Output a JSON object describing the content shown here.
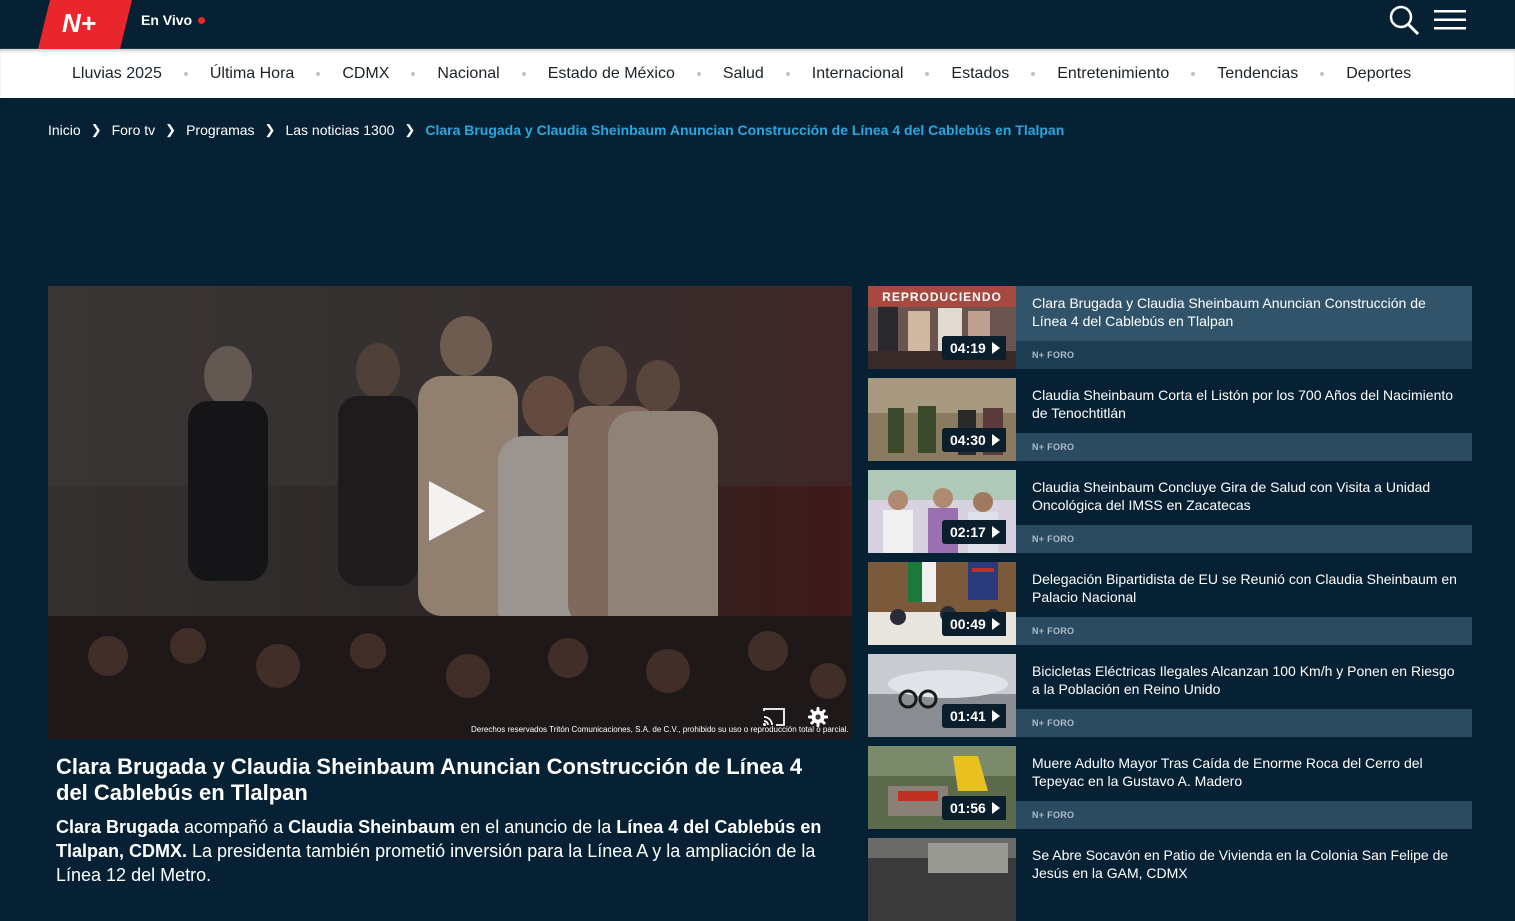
{
  "header": {
    "live_label": "En Vivo",
    "colors": {
      "background": "#062133",
      "logo_red": "#e8262c",
      "accent_blue": "#29a8e0"
    }
  },
  "nav": {
    "items": [
      "Lluvias 2025",
      "Última Hora",
      "CDMX",
      "Nacional",
      "Estado de México",
      "Salud",
      "Internacional",
      "Estados",
      "Entretenimiento",
      "Tendencias",
      "Deportes"
    ]
  },
  "breadcrumb": {
    "items": [
      "Inicio",
      "Foro tv",
      "Programas",
      "Las noticias 1300"
    ],
    "current": "Clara Brugada y Claudia Sheinbaum Anuncian Construcción de Línea 4 del Cablebús en Tlalpan"
  },
  "video": {
    "copyright": "Derechos reservados Tritón Comunicaciones, S.A. de C.V., prohibido su uso o reproducción total o parcial.",
    "title": "Clara Brugada y Claudia Sheinbaum Anuncian Construcción de Línea 4 del Cablebús en Tlalpan",
    "desc": {
      "b1": "Clara Brugada",
      "t1": " acompañó a ",
      "b2": "Claudia Sheinbaum",
      "t2": " en el anuncio de la ",
      "b3": "Línea 4 del Cablebús en Tlalpan, CDMX.",
      "t3": " La presidenta también prometió inversión para la Línea A y la ampliación de la Línea 12 del Metro."
    }
  },
  "playlist": {
    "playing_label": "REPRODUCIENDO",
    "items": [
      {
        "title": "Clara Brugada y Claudia Sheinbaum Anuncian Construcción de Línea 4 del Cablebús en Tlalpan",
        "duration": "04:19",
        "tag": "N+ FORO"
      },
      {
        "title": "Claudia Sheinbaum Corta el Listón por los 700 Años del Nacimiento de Tenochtitlán",
        "duration": "04:30",
        "tag": "N+ FORO"
      },
      {
        "title": "Claudia Sheinbaum Concluye Gira de Salud con Visita a Unidad Oncológica del IMSS en Zacatecas",
        "duration": "02:17",
        "tag": "N+ FORO"
      },
      {
        "title": "Delegación Bipartidista de EU se Reunió con Claudia Sheinbaum en Palacio Nacional",
        "duration": "00:49",
        "tag": "N+ FORO"
      },
      {
        "title": "Bicicletas Eléctricas Ilegales Alcanzan 100 Km/h y Ponen en Riesgo a la Población en Reino Unido",
        "duration": "01:41",
        "tag": "N+ FORO"
      },
      {
        "title": "Muere Adulto Mayor Tras Caída de Enorme Roca del Cerro del Tepeyac en la Gustavo A. Madero",
        "duration": "01:56",
        "tag": "N+ FORO"
      },
      {
        "title": "Se Abre Socavón en Patio de Vivienda en la Colonia San Felipe de Jesús en la GAM, CDMX",
        "duration": "",
        "tag": ""
      }
    ]
  }
}
